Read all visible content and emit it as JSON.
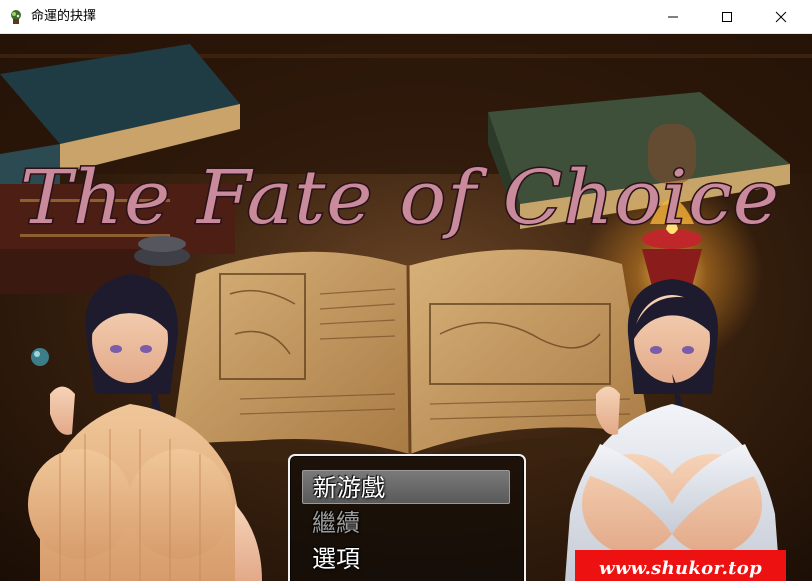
{
  "window": {
    "title": "命運的抉擇",
    "app_icon": "game-app-icon",
    "controls": [
      "minimize-icon",
      "maximize-icon",
      "close-icon"
    ]
  },
  "logo": {
    "text": "The Fate of Choice"
  },
  "menu": {
    "items": [
      {
        "label": "新游戲",
        "state": "selected"
      },
      {
        "label": "繼續",
        "state": "disabled"
      },
      {
        "label": "選項",
        "state": "normal"
      }
    ]
  },
  "watermark": {
    "text": "www.shukor.top",
    "color": "#ee1111"
  },
  "colors": {
    "logo_fill": "#c98a9c",
    "logo_outline": "#2a1218",
    "menu_border": "#f2f2f2",
    "lamp_flame": "#ffcc33"
  }
}
